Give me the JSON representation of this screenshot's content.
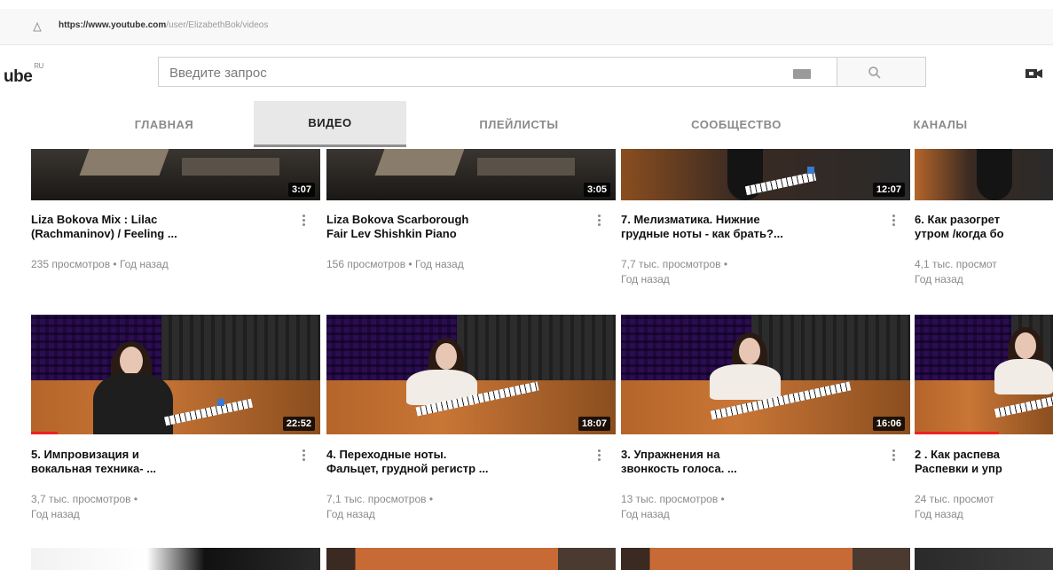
{
  "browser": {
    "url_host": "https://www.youtube.com",
    "url_path": "/user/ElizabethBok/videos"
  },
  "header": {
    "logo_text": "ube",
    "logo_region": "RU",
    "search_placeholder": "Введите запрос"
  },
  "tabs": [
    {
      "label": "ГЛАВНАЯ",
      "active": false
    },
    {
      "label": "ВИДЕО",
      "active": true
    },
    {
      "label": "ПЛЕЙЛИСТЫ",
      "active": false
    },
    {
      "label": "СООБЩЕСТВО",
      "active": false
    },
    {
      "label": "КАНАЛЫ",
      "active": false
    }
  ],
  "row1": [
    {
      "duration": "3:07",
      "title1": "Liza Bokova Mix : Lilac",
      "title2": "(Rachmaninov) / Feeling ...",
      "meta1": "235 просмотров • Год назад",
      "meta2": ""
    },
    {
      "duration": "3:05",
      "title1": "Liza Bokova Scarborough",
      "title2": "Fair Lev Shishkin Piano",
      "meta1": "156 просмотров • Год назад",
      "meta2": ""
    },
    {
      "duration": "12:07",
      "title1": "7. Мелизматика. Нижние",
      "title2": "грудные ноты - как брать?...",
      "meta1": "7,7 тыс. просмотров •",
      "meta2": "Год назад"
    },
    {
      "duration": "",
      "title1": "6. Как разогрет",
      "title2": "утром /когда бо",
      "meta1": "4,1 тыс. просмот",
      "meta2": "Год назад"
    }
  ],
  "row2": [
    {
      "duration": "22:52",
      "title1": "5. Импровизация и",
      "title2": "вокальная техника- ...",
      "meta1": "3,7 тыс. просмотров •",
      "meta2": "Год назад"
    },
    {
      "duration": "18:07",
      "title1": "4. Переходные ноты.",
      "title2": "Фальцет, грудной регистр ...",
      "meta1": "7,1 тыс. просмотров •",
      "meta2": "Год назад"
    },
    {
      "duration": "16:06",
      "title1": "3. Упражнения на",
      "title2": "звонкость голоса. ...",
      "meta1": "13 тыс. просмотров •",
      "meta2": "Год назад"
    },
    {
      "duration": "",
      "title1": "2 . Как распева",
      "title2": "Распевки и упр",
      "meta1": "24 тыс. просмот",
      "meta2": "Год назад"
    }
  ],
  "colors": {
    "progress_red": "#e22222",
    "active_tab_bg": "#e8e8e8"
  }
}
